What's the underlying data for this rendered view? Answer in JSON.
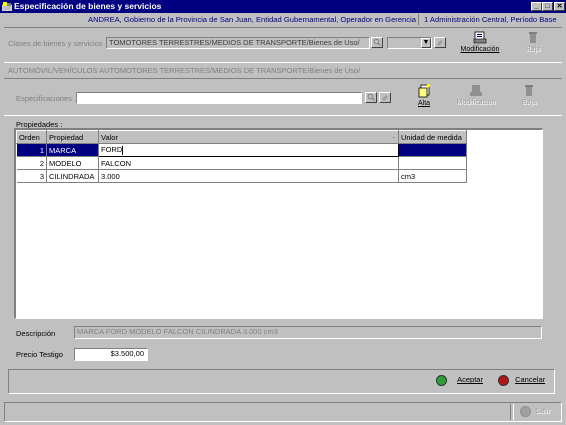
{
  "window": {
    "title": "Especificación de bienes y servicios",
    "minimize": "_",
    "maximize": "□",
    "close": "✕"
  },
  "user_line": {
    "context": "ANDREA, Gobierno de la Provincia de San Juan, Entidad Gubernamental, Operador en Gerencia",
    "period": "1 Administración Central, Período Base"
  },
  "clases": {
    "label": "Clases de bienes y servicios",
    "value": "TOMOTORES TERRESTRES/MEDIOS DE TRANSPORTE/Bienes de Uso/",
    "modificacion_label": "Modificación",
    "baja_label": "Baja"
  },
  "path_text": "AUTOMÓVIL/VEHÍCULOS AUTOMOTORES TERRESTRES/MEDIOS DE TRANSPORTE/Bienes de Uso/",
  "especificaciones": {
    "label": "Especificaciones",
    "value": "",
    "alta_label": "Alta",
    "modificacion_label": "Modificación",
    "baja_label": "Baja"
  },
  "propiedades": {
    "label": "Propiedades :",
    "columns": [
      "Orden",
      "Propiedad",
      "Valor",
      "Unidad de medida"
    ],
    "rows": [
      {
        "orden": "1",
        "propiedad": "MARCA",
        "valor": "FORD",
        "unidad": ""
      },
      {
        "orden": "2",
        "propiedad": "MODELO",
        "valor": "FALCON",
        "unidad": ""
      },
      {
        "orden": "3",
        "propiedad": "CILINDRADA",
        "valor": "3.000",
        "unidad": "cm3"
      }
    ]
  },
  "descripcion": {
    "label": "Descripción",
    "value": "MARCA FORD MODELO FALCON CILINDRADA 3.000 cm3"
  },
  "precio": {
    "label": "Precio Testigo",
    "value": "$3.500,00"
  },
  "actions": {
    "aceptar": "Aceptar",
    "cancelar": "Cancelar",
    "salir": "Salir"
  },
  "colors": {
    "title_bar": "#000080",
    "accept": "#2e9e3a",
    "cancel": "#b01818"
  }
}
